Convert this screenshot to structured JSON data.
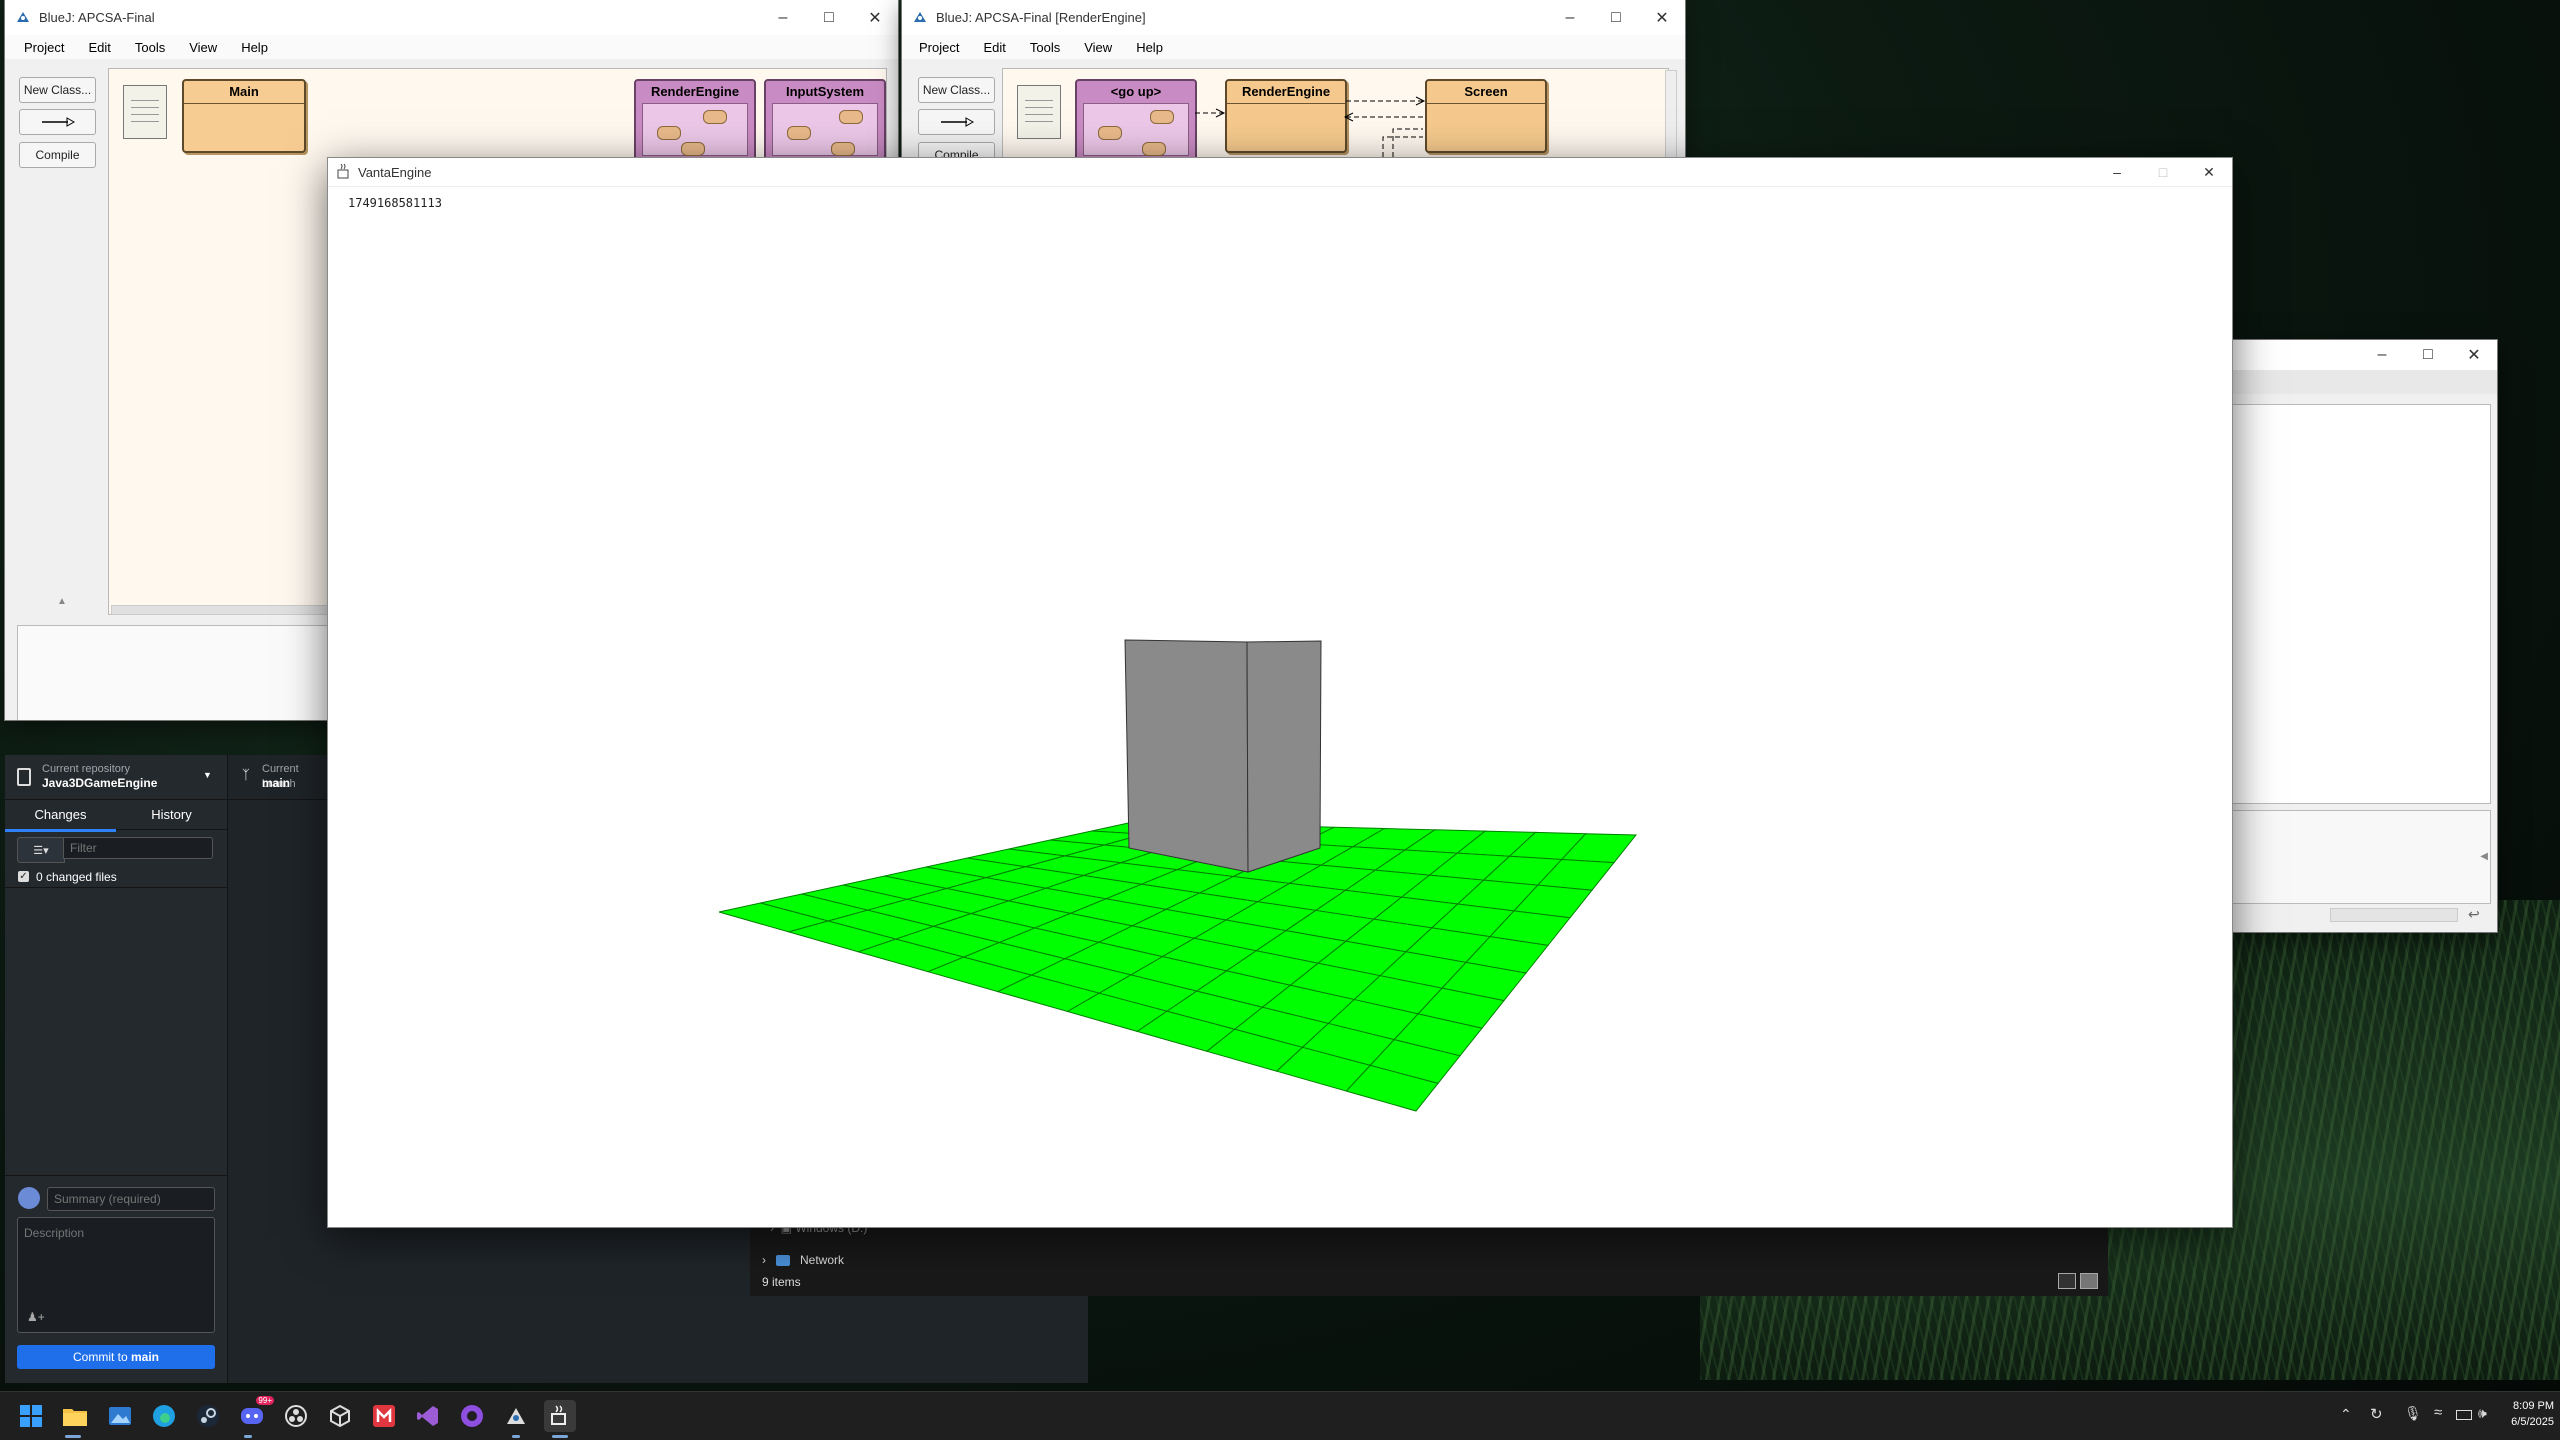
{
  "bluej_left": {
    "title": "BlueJ:  APCSA-Final",
    "menu": [
      "Project",
      "Edit",
      "Tools",
      "View",
      "Help"
    ],
    "buttons": {
      "new_class": "New Class...",
      "compile": "Compile"
    },
    "classes": [
      {
        "name": "Main",
        "kind": "class"
      },
      {
        "name": "RenderEngine",
        "kind": "package"
      },
      {
        "name": "InputSystem",
        "kind": "package"
      }
    ]
  },
  "bluej_right": {
    "title": "BlueJ:  APCSA-Final  [RenderEngine]",
    "menu": [
      "Project",
      "Edit",
      "Tools",
      "View",
      "Help"
    ],
    "buttons": {
      "new_class": "New Class...",
      "compile": "Compile"
    },
    "classes": [
      {
        "name": "<go up>",
        "kind": "package"
      },
      {
        "name": "RenderEngine",
        "kind": "class"
      },
      {
        "name": "Screen",
        "kind": "class"
      }
    ]
  },
  "vanta": {
    "title": "VantaEngine",
    "timestamp": "1749168581113",
    "cube_color": "#8a8a8a",
    "floor_color": "#00ff00"
  },
  "github_desktop": {
    "current_repository_label": "Current repository",
    "current_repository": "Java3DGameEngine",
    "current_branch_label": "Current branch",
    "current_branch": "main",
    "tabs": [
      "Changes",
      "History"
    ],
    "filter_placeholder": "Filter",
    "changed_files": "0 changed files",
    "summary_placeholder": "Summary (required)",
    "description_placeholder": "Description",
    "commit_prefix": "Commit to ",
    "commit_branch": "main"
  },
  "explorer": {
    "items": [
      "Windows (D:)",
      "Network"
    ],
    "status": "9 items"
  },
  "taskbar": {
    "time": "8:09 PM",
    "date": "6/5/2025",
    "discord_badge": "99+"
  }
}
